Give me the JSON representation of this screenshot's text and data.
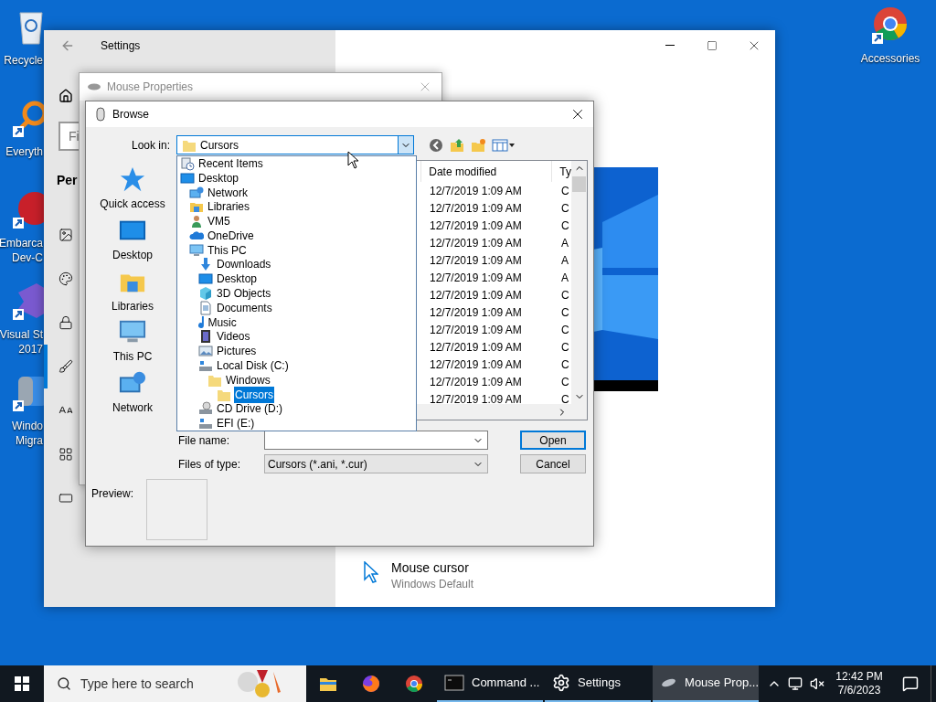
{
  "desktop": {
    "left_icons": [
      {
        "kind": "recycle",
        "lines": [
          "Recycle"
        ]
      },
      {
        "kind": "magnifier",
        "lines": [
          "Everyth"
        ]
      },
      {
        "kind": "devcpp",
        "lines": [
          "Embarca",
          "Dev-C"
        ]
      },
      {
        "kind": "vs",
        "lines": [
          "Visual St",
          "2017"
        ]
      },
      {
        "kind": "migration",
        "lines": [
          "Windo",
          "Migra"
        ]
      }
    ],
    "right_icons": [
      {
        "kind": "chrome",
        "lines": [
          "Accessories"
        ]
      }
    ]
  },
  "settings": {
    "title": "Settings",
    "search": {
      "placeholder": "Fi"
    },
    "heading": "Per",
    "nav_items": [
      {
        "kind": "background",
        "selected": false
      },
      {
        "kind": "colors",
        "selected": false
      },
      {
        "kind": "lock",
        "selected": false
      },
      {
        "kind": "themes",
        "selected": true
      },
      {
        "kind": "fonts",
        "selected": false
      },
      {
        "kind": "start",
        "selected": false
      },
      {
        "kind": "taskbar",
        "selected": false
      }
    ],
    "mouse_cursor": {
      "title": "Mouse cursor",
      "value": "Windows Default"
    }
  },
  "mouse_properties": {
    "title": "Mouse Properties"
  },
  "browse": {
    "title": "Browse",
    "look_in": {
      "label": "Look in:",
      "value": "Cursors",
      "options": [
        {
          "label": "Recent Items",
          "kind": "recent",
          "selected": false
        },
        {
          "label": "Desktop",
          "kind": "desktop",
          "selected": false,
          "children": [
            {
              "label": "Network",
              "kind": "network",
              "selected": false
            },
            {
              "label": "Libraries",
              "kind": "libraries",
              "selected": false
            },
            {
              "label": "VM5",
              "kind": "user",
              "selected": false
            },
            {
              "label": "OneDrive",
              "kind": "cloud",
              "selected": false
            },
            {
              "label": "This PC",
              "kind": "pc",
              "selected": false,
              "children": [
                {
                  "label": "Downloads",
                  "kind": "download",
                  "selected": false
                },
                {
                  "label": "Desktop",
                  "kind": "desktop",
                  "selected": false
                },
                {
                  "label": "3D Objects",
                  "kind": "cube",
                  "selected": false
                },
                {
                  "label": "Documents",
                  "kind": "document",
                  "selected": false
                },
                {
                  "label": "Music",
                  "kind": "music",
                  "selected": false
                },
                {
                  "label": "Videos",
                  "kind": "video",
                  "selected": false
                },
                {
                  "label": "Pictures",
                  "kind": "picture",
                  "selected": false
                },
                {
                  "label": "Local Disk (C:)",
                  "kind": "drive",
                  "selected": false,
                  "children": [
                    {
                      "label": "Windows",
                      "kind": "folder",
                      "selected": false,
                      "children": [
                        {
                          "label": "Cursors",
                          "kind": "folder",
                          "selected": true
                        }
                      ]
                    }
                  ]
                },
                {
                  "label": "CD Drive (D:)",
                  "kind": "cd",
                  "selected": false
                },
                {
                  "label": "EFI (E:)",
                  "kind": "drive",
                  "selected": false
                }
              ]
            }
          ]
        }
      ]
    },
    "places": [
      {
        "label": "Quick access",
        "kind": "star"
      },
      {
        "label": "Desktop",
        "kind": "desktop"
      },
      {
        "label": "Libraries",
        "kind": "libraries"
      },
      {
        "label": "This PC",
        "kind": "pc"
      },
      {
        "label": "Network",
        "kind": "network"
      }
    ],
    "file_list": {
      "columns": [
        "Date modified",
        "Ty"
      ],
      "rows": [
        {
          "cells": [
            "12/7/2019 1:09 AM",
            "C"
          ]
        },
        {
          "cells": [
            "12/7/2019 1:09 AM",
            "C"
          ]
        },
        {
          "cells": [
            "12/7/2019 1:09 AM",
            "C"
          ]
        },
        {
          "cells": [
            "12/7/2019 1:09 AM",
            "A"
          ]
        },
        {
          "cells": [
            "12/7/2019 1:09 AM",
            "A"
          ]
        },
        {
          "cells": [
            "12/7/2019 1:09 AM",
            "A"
          ]
        },
        {
          "cells": [
            "12/7/2019 1:09 AM",
            "C"
          ]
        },
        {
          "cells": [
            "12/7/2019 1:09 AM",
            "C"
          ]
        },
        {
          "cells": [
            "12/7/2019 1:09 AM",
            "C"
          ]
        },
        {
          "cells": [
            "12/7/2019 1:09 AM",
            "C"
          ]
        },
        {
          "cells": [
            "12/7/2019 1:09 AM",
            "C"
          ]
        },
        {
          "cells": [
            "12/7/2019 1:09 AM",
            "C"
          ]
        },
        {
          "cells": [
            "12/7/2019 1:09 AM",
            "C"
          ]
        }
      ]
    },
    "file_name": {
      "label": "File name:"
    },
    "files_of_type": {
      "label": "Files of type:",
      "value": "Cursors (*.ani, *.cur)"
    },
    "buttons": [
      {
        "label": "Open",
        "default": true
      },
      {
        "label": "Cancel",
        "default": false
      }
    ],
    "preview": {
      "label": "Preview:"
    }
  },
  "taskbar": {
    "search": {
      "placeholder": "Type here to search"
    },
    "apps": [
      {
        "kind": "explorer",
        "active": false
      },
      {
        "kind": "firefox",
        "active": false
      },
      {
        "kind": "chrome",
        "active": false
      },
      {
        "kind": "terminal",
        "label": "Command ...",
        "active": false
      },
      {
        "kind": "gear",
        "label": "Settings",
        "active": false
      },
      {
        "kind": "mouse",
        "label": "Mouse Prop...",
        "active": true
      }
    ],
    "clock": {
      "time": "12:42 PM",
      "date": "7/6/2023"
    }
  }
}
